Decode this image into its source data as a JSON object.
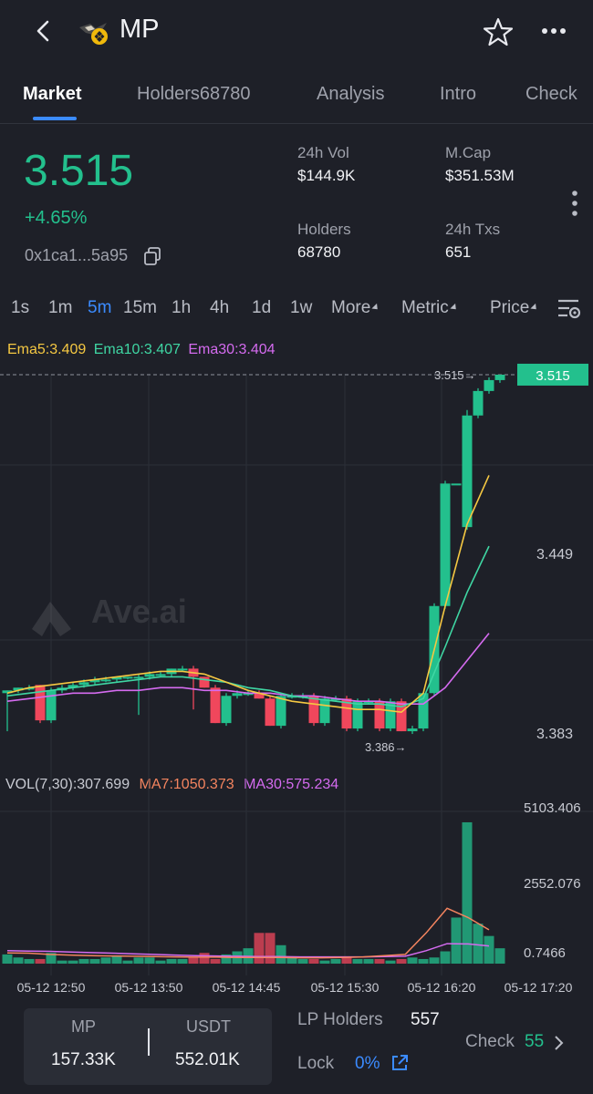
{
  "header": {
    "title": "MP"
  },
  "tabs": [
    {
      "label": "Market",
      "active": true
    },
    {
      "label": "Holders68780",
      "active": false
    },
    {
      "label": "Analysis",
      "active": false
    },
    {
      "label": "Intro",
      "active": false
    },
    {
      "label": "Check",
      "active": false
    }
  ],
  "token": {
    "price": "3.515",
    "change": "+4.65%",
    "address": "0x1ca1...5a95"
  },
  "stats": {
    "vol24h_label": "24h Vol",
    "vol24h": "$144.9K",
    "mcap_label": "M.Cap",
    "mcap": "$351.53M",
    "holders_label": "Holders",
    "holders": "68780",
    "txs_label": "24h Txs",
    "txs": "651"
  },
  "timeframes": [
    {
      "label": "1s",
      "active": false
    },
    {
      "label": "1m",
      "active": false
    },
    {
      "label": "5m",
      "active": true
    },
    {
      "label": "15m",
      "active": false
    },
    {
      "label": "1h",
      "active": false
    },
    {
      "label": "4h",
      "active": false
    },
    {
      "label": "1d",
      "active": false
    },
    {
      "label": "1w",
      "active": false
    },
    {
      "label": "More",
      "active": false,
      "dropdown": true
    },
    {
      "label": "Metric",
      "active": false,
      "dropdown": true
    },
    {
      "label": "Price",
      "active": false,
      "dropdown": true
    }
  ],
  "indicators": {
    "ema5": "Ema5:3.409",
    "ema10": "Ema10:3.407",
    "ema30": "Ema30:3.404",
    "vol": "VOL(7,30):307.699",
    "ma7": "MA7:1050.373",
    "ma30": "MA30:575.234"
  },
  "colors": {
    "up": "#23c08d",
    "down": "#f0475c",
    "ema5": "#f5c842",
    "ema10": "#3fd6a3",
    "ema30": "#d56bf0",
    "ma7": "#f4845f",
    "ma30": "#d56bf0",
    "accent": "#3b8bff"
  },
  "chart_data": {
    "type": "candlestick",
    "price_axis": {
      "ticks": [
        "3.449",
        "3.383"
      ],
      "current": "3.515",
      "high_label": "3.515→",
      "low_label": "3.386→"
    },
    "volume_axis": {
      "ticks": [
        "5103.406",
        "2552.076",
        "0.7466"
      ]
    },
    "x_labels": [
      "05-12 12:50",
      "05-12 13:50",
      "05-12 14:45",
      "05-12 15:30",
      "05-12 16:20",
      "05-12 17:20"
    ],
    "candles": [
      [
        3.398,
        3.399,
        3.384,
        3.399
      ],
      [
        3.399,
        3.4,
        3.398,
        3.4
      ],
      [
        3.4,
        3.401,
        3.399,
        3.4
      ],
      [
        3.401,
        3.401,
        3.387,
        3.388
      ],
      [
        3.388,
        3.4,
        3.387,
        3.399
      ],
      [
        3.399,
        3.401,
        3.398,
        3.4
      ],
      [
        3.4,
        3.402,
        3.399,
        3.401
      ],
      [
        3.401,
        3.403,
        3.4,
        3.402
      ],
      [
        3.402,
        3.404,
        3.401,
        3.403
      ],
      [
        3.403,
        3.404,
        3.402,
        3.403
      ],
      [
        3.403,
        3.404,
        3.402,
        3.404
      ],
      [
        3.404,
        3.404,
        3.403,
        3.404
      ],
      [
        3.404,
        3.405,
        3.39,
        3.404
      ],
      [
        3.404,
        3.406,
        3.403,
        3.405
      ],
      [
        3.405,
        3.406,
        3.404,
        3.405
      ],
      [
        3.405,
        3.407,
        3.404,
        3.407
      ],
      [
        3.407,
        3.408,
        3.406,
        3.407
      ],
      [
        3.407,
        3.408,
        3.392,
        3.404
      ],
      [
        3.404,
        3.404,
        3.4,
        3.4
      ],
      [
        3.4,
        3.401,
        3.387,
        3.387
      ],
      [
        3.387,
        3.398,
        3.386,
        3.397
      ],
      [
        3.397,
        3.399,
        3.396,
        3.398
      ],
      [
        3.398,
        3.399,
        3.397,
        3.398
      ],
      [
        3.398,
        3.399,
        3.396,
        3.396
      ],
      [
        3.396,
        3.397,
        3.386,
        3.386
      ],
      [
        3.386,
        3.398,
        3.385,
        3.397
      ],
      [
        3.397,
        3.398,
        3.396,
        3.397
      ],
      [
        3.397,
        3.398,
        3.396,
        3.397
      ],
      [
        3.397,
        3.398,
        3.386,
        3.387
      ],
      [
        3.387,
        3.397,
        3.386,
        3.396
      ],
      [
        3.396,
        3.397,
        3.395,
        3.396
      ],
      [
        3.396,
        3.397,
        3.384,
        3.385
      ],
      [
        3.385,
        3.396,
        3.384,
        3.395
      ],
      [
        3.395,
        3.396,
        3.394,
        3.395
      ],
      [
        3.395,
        3.396,
        3.384,
        3.385
      ],
      [
        3.385,
        3.396,
        3.384,
        3.395
      ],
      [
        3.395,
        3.396,
        3.384,
        3.384
      ],
      [
        3.384,
        3.386,
        3.383,
        3.385
      ],
      [
        3.385,
        3.398,
        3.384,
        3.398
      ],
      [
        3.398,
        3.431,
        3.397,
        3.43
      ],
      [
        3.43,
        3.476,
        3.429,
        3.475
      ],
      [
        3.475,
        3.475,
        3.475,
        3.475
      ],
      [
        3.459,
        3.502,
        3.458,
        3.5
      ],
      [
        3.5,
        3.51,
        3.499,
        3.509
      ],
      [
        3.509,
        3.514,
        3.508,
        3.513
      ],
      [
        3.513,
        3.515,
        3.512,
        3.515
      ]
    ],
    "ema5": [
      3.398,
      3.4,
      3.401,
      3.402,
      3.403,
      3.404,
      3.405,
      3.406,
      3.406,
      3.405,
      3.402,
      3.399,
      3.397,
      3.395,
      3.394,
      3.393,
      3.392,
      3.392,
      3.391,
      3.398,
      3.43,
      3.46,
      3.478
    ],
    "ema10": [
      3.397,
      3.398,
      3.399,
      3.4,
      3.401,
      3.402,
      3.403,
      3.404,
      3.404,
      3.403,
      3.402,
      3.4,
      3.399,
      3.397,
      3.396,
      3.395,
      3.394,
      3.394,
      3.393,
      3.396,
      3.415,
      3.435,
      3.452
    ],
    "ema30": [
      3.395,
      3.396,
      3.397,
      3.398,
      3.398,
      3.399,
      3.399,
      3.4,
      3.4,
      3.399,
      3.399,
      3.398,
      3.398,
      3.397,
      3.397,
      3.396,
      3.395,
      3.395,
      3.394,
      3.394,
      3.4,
      3.41,
      3.42
    ],
    "volumes": [
      300,
      200,
      150,
      150,
      350,
      100,
      100,
      150,
      150,
      200,
      250,
      100,
      200,
      200,
      100,
      150,
      150,
      200,
      350,
      150,
      300,
      400,
      500,
      1000,
      1000,
      600,
      200,
      150,
      150,
      100,
      150,
      200,
      150,
      150,
      150,
      100,
      150,
      200,
      150,
      200,
      400,
      1500,
      4600,
      1300,
      900,
      500
    ],
    "vol_up": [
      true,
      true,
      true,
      false,
      true,
      true,
      true,
      true,
      true,
      true,
      true,
      true,
      true,
      true,
      true,
      true,
      true,
      false,
      false,
      false,
      true,
      true,
      true,
      false,
      false,
      true,
      true,
      true,
      false,
      true,
      true,
      false,
      true,
      true,
      false,
      true,
      false,
      true,
      true,
      true,
      true,
      true,
      true,
      true,
      true,
      true
    ],
    "ma7": [
      350,
      340,
      300,
      280,
      260,
      250,
      240,
      230,
      220,
      210,
      210,
      200,
      200,
      200,
      190,
      190,
      200,
      220,
      260,
      300,
      1000,
      1800,
      1500,
      1100
    ],
    "ma30": [
      420,
      410,
      400,
      380,
      360,
      340,
      320,
      300,
      280,
      260,
      250,
      240,
      230,
      230,
      220,
      220,
      220,
      220,
      230,
      240,
      420,
      650,
      640,
      575
    ]
  },
  "watermark": "Ave.ai",
  "bottom": {
    "base_symbol": "MP",
    "base_amount": "157.33K",
    "quote_symbol": "USDT",
    "quote_amount": "552.01K",
    "lp_holders_label": "LP Holders",
    "lp_holders": "557",
    "lock_label": "Lock",
    "lock_value": "0%",
    "check_label": "Check",
    "check_value": "55"
  }
}
